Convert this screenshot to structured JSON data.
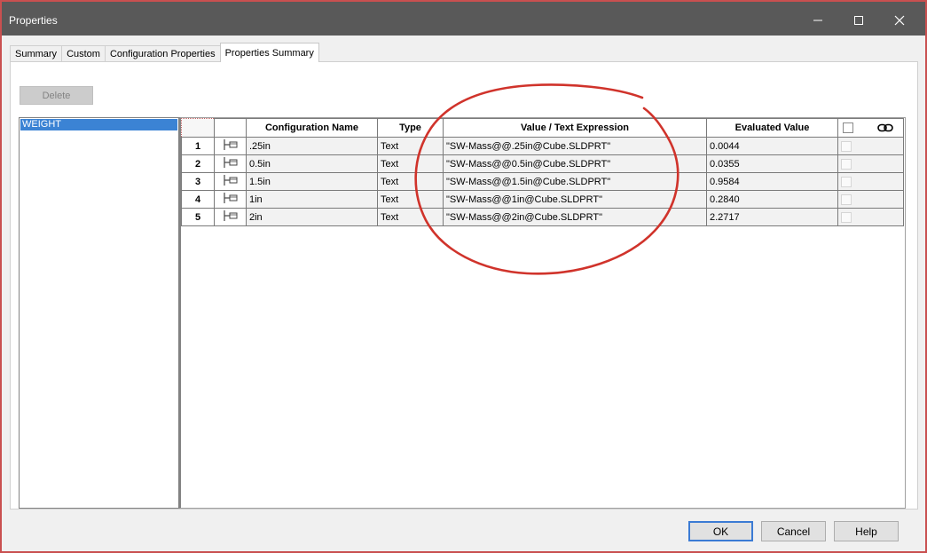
{
  "window": {
    "title": "Properties"
  },
  "tabs": [
    {
      "label": "Summary"
    },
    {
      "label": "Custom"
    },
    {
      "label": "Configuration Properties"
    },
    {
      "label": "Properties Summary"
    }
  ],
  "toolbar": {
    "delete_label": "Delete"
  },
  "property_list": {
    "items": [
      {
        "label": "WEIGHT"
      }
    ]
  },
  "grid": {
    "columns": {
      "config_name": "Configuration Name",
      "type": "Type",
      "value": "Value / Text Expression",
      "evaluated": "Evaluated Value"
    },
    "rows": [
      {
        "num": "1",
        "config": ".25in",
        "type": "Text",
        "expression": "\"SW-Mass@@.25in@Cube.SLDPRT\"",
        "evaluated": "0.0044"
      },
      {
        "num": "2",
        "config": "0.5in",
        "type": "Text",
        "expression": "\"SW-Mass@@0.5in@Cube.SLDPRT\"",
        "evaluated": "0.0355"
      },
      {
        "num": "3",
        "config": "1.5in",
        "type": "Text",
        "expression": "\"SW-Mass@@1.5in@Cube.SLDPRT\"",
        "evaluated": "0.9584"
      },
      {
        "num": "4",
        "config": "1in",
        "type": "Text",
        "expression": "\"SW-Mass@@1in@Cube.SLDPRT\"",
        "evaluated": "0.2840"
      },
      {
        "num": "5",
        "config": "2in",
        "type": "Text",
        "expression": "\"SW-Mass@@2in@Cube.SLDPRT\"",
        "evaluated": "2.2717"
      }
    ]
  },
  "buttons": {
    "ok": "OK",
    "cancel": "Cancel",
    "help": "Help"
  },
  "colors": {
    "titlebar": "#595959",
    "selection": "#3b83d4",
    "annotation": "#d0332b",
    "ok_border": "#3b7bd4"
  },
  "icons": {
    "configuration": "configuration-icon",
    "link": "link-icon",
    "minimize": "minimize-icon",
    "maximize": "maximize-icon",
    "close": "close-icon"
  }
}
